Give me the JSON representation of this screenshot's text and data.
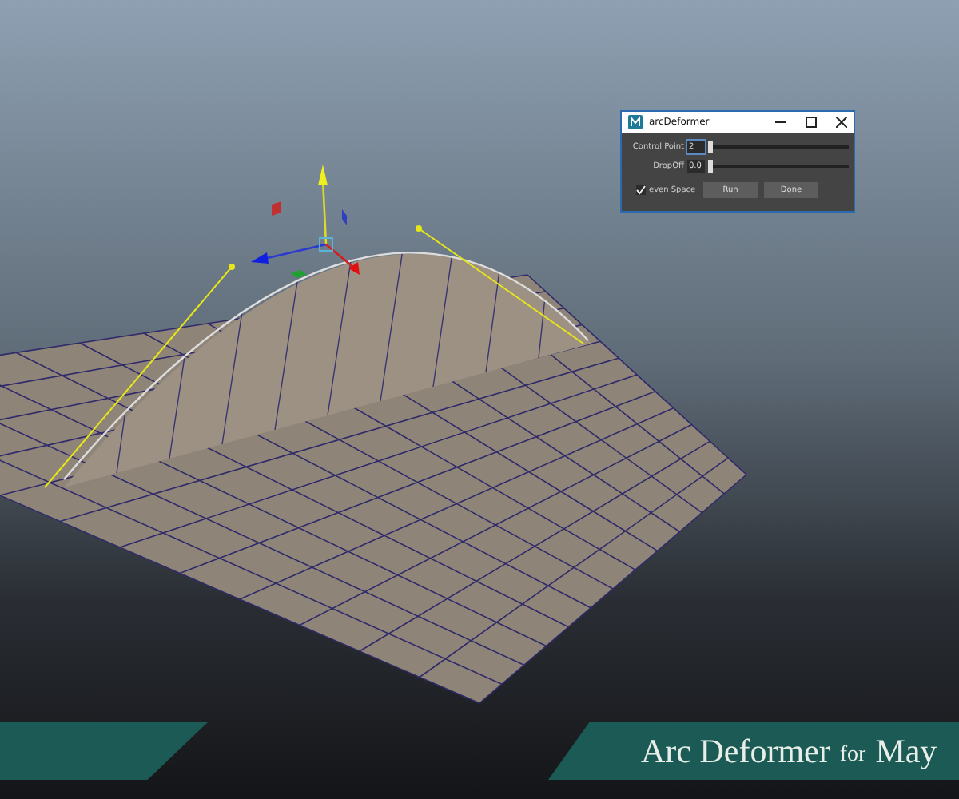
{
  "dialog": {
    "title": "arcDeformer",
    "fields": [
      {
        "label": "Control Point",
        "value": "2",
        "level": 0.0,
        "focused": true
      },
      {
        "label": "DropOff",
        "value": "0.0",
        "level": 0.0,
        "focused": false
      }
    ],
    "checkbox": {
      "label": "even Space",
      "checked": true
    },
    "buttons": [
      "Run",
      "Done"
    ]
  },
  "banner": {
    "title": "Arc Deformer",
    "connector": "for",
    "product": "May"
  }
}
